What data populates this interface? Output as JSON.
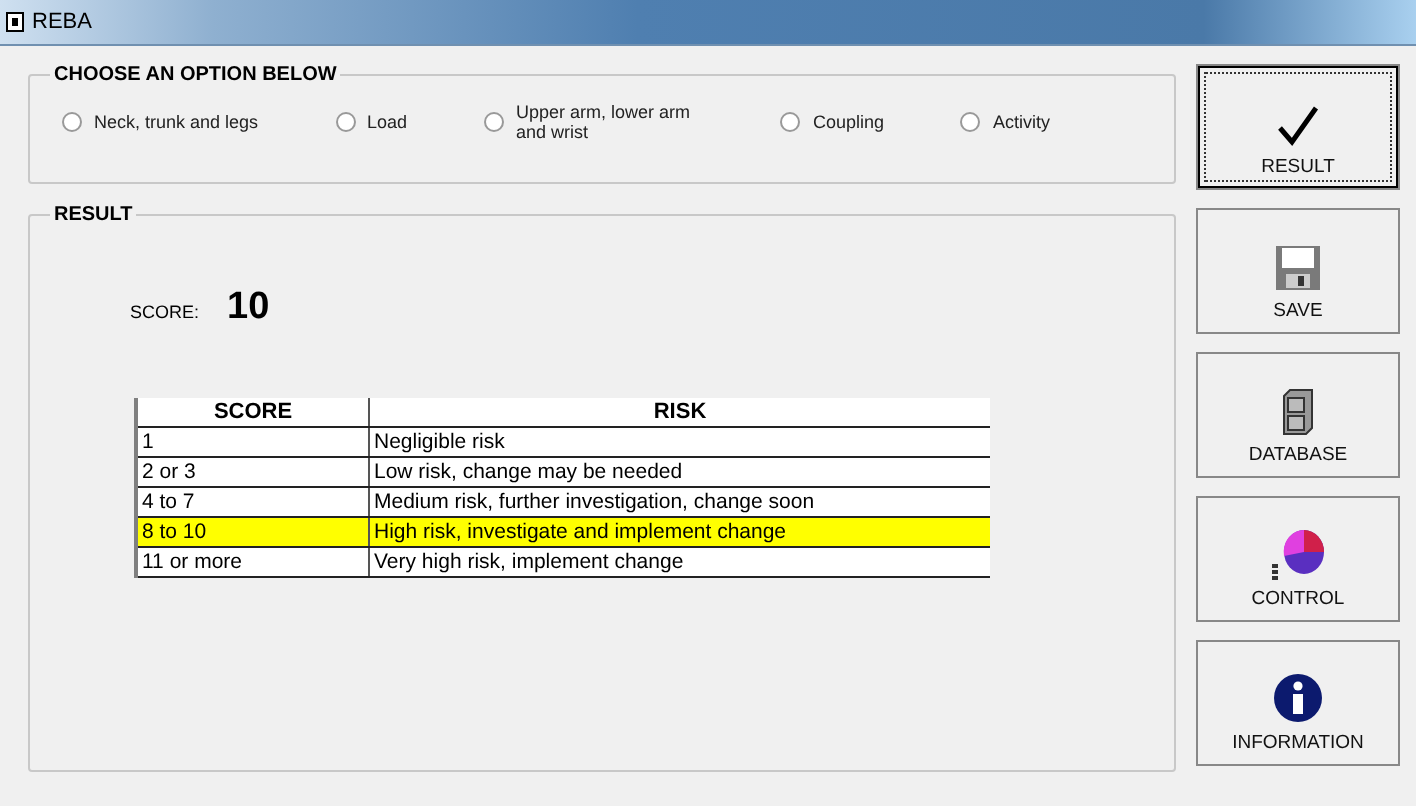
{
  "window": {
    "title": "REBA"
  },
  "options": {
    "title": "CHOOSE AN OPTION BELOW",
    "items": [
      {
        "label": "Neck, trunk and legs",
        "selected": false
      },
      {
        "label": "Load",
        "selected": false
      },
      {
        "label": "Upper arm, lower arm and wrist",
        "selected": false
      },
      {
        "label": "Coupling",
        "selected": false
      },
      {
        "label": "Activity",
        "selected": false
      }
    ]
  },
  "result": {
    "title": "RESULT",
    "score_label": "SCORE:",
    "score": "10",
    "table": {
      "columns": [
        "SCORE",
        "RISK"
      ],
      "rows": [
        {
          "cells": [
            "1",
            "Negligible risk"
          ],
          "selected": false
        },
        {
          "cells": [
            "2 or 3",
            "Low risk, change may be needed"
          ],
          "selected": false
        },
        {
          "cells": [
            "4 to 7",
            "Medium risk, further investigation, change soon"
          ],
          "selected": false
        },
        {
          "cells": [
            "8 to 10",
            "High risk, investigate and implement change"
          ],
          "selected": true
        },
        {
          "cells": [
            "11 or more",
            "Very high risk, implement change"
          ],
          "selected": false
        }
      ]
    }
  },
  "buttons": [
    {
      "kind": "check",
      "label": "RESULT",
      "focused": true
    },
    {
      "kind": "save",
      "label": "SAVE",
      "focused": false
    },
    {
      "kind": "database",
      "label": "DATABASE",
      "focused": false
    },
    {
      "kind": "control",
      "label": "CONTROL",
      "focused": false
    },
    {
      "kind": "info",
      "label": "INFORMATION",
      "focused": false
    }
  ]
}
